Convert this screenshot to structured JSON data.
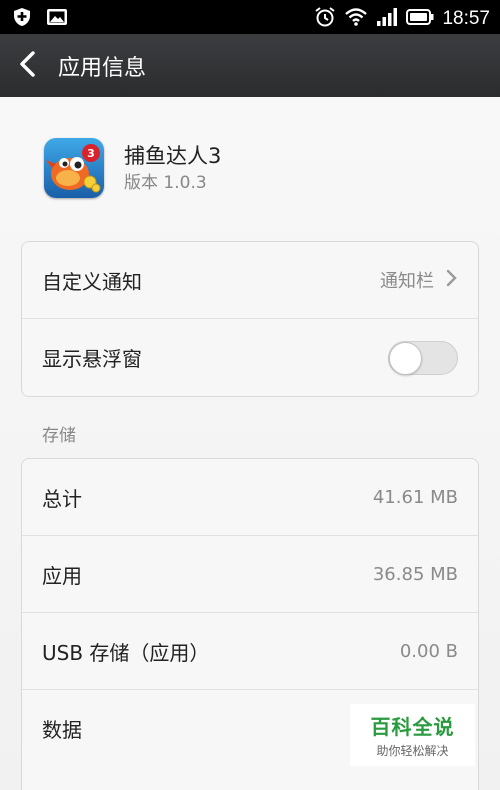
{
  "status_bar": {
    "time": "18:57",
    "icons": [
      "shield-icon",
      "image-icon",
      "alarm-icon",
      "wifi-icon",
      "signal-icon",
      "battery-icon"
    ]
  },
  "action_bar": {
    "title": "应用信息",
    "back_icon": "chevron-left-icon"
  },
  "app": {
    "name": "捕鱼达人3",
    "version": "版本 1.0.3"
  },
  "settings": {
    "custom_notify_label": "自定义通知",
    "custom_notify_value": "通知栏",
    "float_window_label": "显示悬浮窗",
    "float_window_on": false
  },
  "storage": {
    "section_label": "存储",
    "rows": [
      {
        "label": "总计",
        "value": "41.61 MB"
      },
      {
        "label": "应用",
        "value": "36.85 MB"
      },
      {
        "label": "USB 存储（应用）",
        "value": "0.00 B"
      },
      {
        "label": "数据",
        "value": ""
      }
    ]
  },
  "watermark": {
    "title": "百科全说",
    "subtitle": "助你轻松解决"
  },
  "colors": {
    "action_bar": "#2f3033",
    "watermark_green": "#2a9a3e"
  }
}
